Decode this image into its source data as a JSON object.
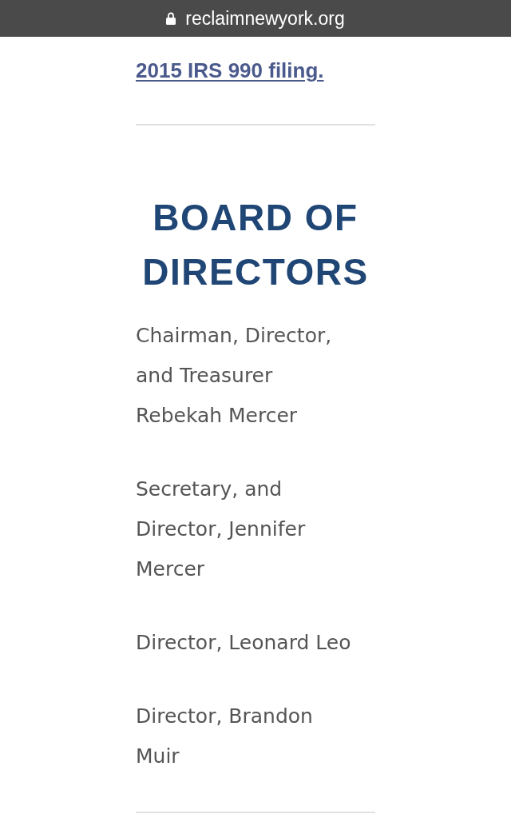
{
  "address_bar": {
    "url": "reclaimnewyork.org"
  },
  "filing_link": {
    "text": "2015 IRS 990 filing."
  },
  "board": {
    "heading": "BOARD OF DIRECTORS",
    "entries": [
      {
        "lines": [
          "Chairman, Director,",
          "and Treasurer",
          "Rebekah Mercer"
        ]
      },
      {
        "lines": [
          "Secretary, and",
          "Director, Jennifer",
          "Mercer"
        ]
      },
      {
        "lines": [
          "Director, Leonard Leo"
        ]
      },
      {
        "lines": [
          "Director, Brandon",
          "Muir"
        ]
      }
    ]
  }
}
